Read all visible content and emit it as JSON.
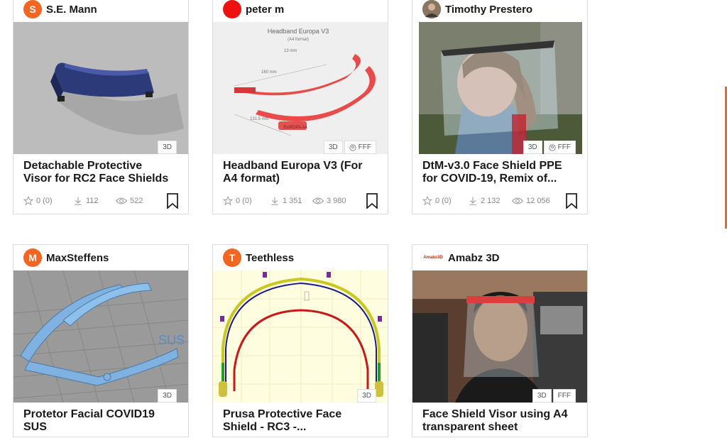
{
  "cards": [
    {
      "author": "S.E. Mann",
      "avatar_letter": "S",
      "title_line1": "Detachable Protective",
      "title_line2": "Visor for RC2 Face Shields",
      "badges": [
        "3D"
      ],
      "likes": "0 (0)",
      "downloads": "112",
      "views": "522"
    },
    {
      "author": "peter m",
      "avatar_letter": "",
      "title_line1": "Headband Europa V3 (For",
      "title_line2": "A4 format)",
      "badges": [
        "3D",
        "FFF"
      ],
      "likes": "0 (0)",
      "downloads": "1 351",
      "views": "3 980",
      "thumb_texts": {
        "heading": "Headband Europa V3",
        "sub": "(A4 format)",
        "d1": "13 mm",
        "d2": "160 mm",
        "d3": "131.5 mm",
        "emboss": "EUROPA A4"
      }
    },
    {
      "author": "Timothy Prestero",
      "avatar_letter": "",
      "title_line1": "DtM-v3.0 Face Shield PPE",
      "title_line2": "for COVID-19, Remix of...",
      "badges": [
        "3D",
        "FFF"
      ],
      "likes": "0 (0)",
      "downloads": "2 132",
      "views": "12 056"
    },
    {
      "author": "MaxSteffens",
      "avatar_letter": "M",
      "title_line1": "Protetor Facial COVID19",
      "title_line2": "SUS",
      "badges": [
        "3D"
      ],
      "thumb_texts": {
        "emboss": "SUS"
      }
    },
    {
      "author": "Teethless",
      "avatar_letter": "T",
      "title_line1": "Prusa Protective Face",
      "title_line2": "Shield - RC3 -...",
      "badges": [
        "3D"
      ]
    },
    {
      "author": "Amabz 3D",
      "avatar_letter": "",
      "avatar_logo": "Amabz3D",
      "title_line1": "Face Shield Visor using A4",
      "title_line2": "transparent sheet",
      "badges": [
        "3D",
        "FFF"
      ]
    }
  ],
  "colors": {
    "accent": "#f26522",
    "avatar": "#f26522",
    "peter_avatar": "#ee1111"
  }
}
